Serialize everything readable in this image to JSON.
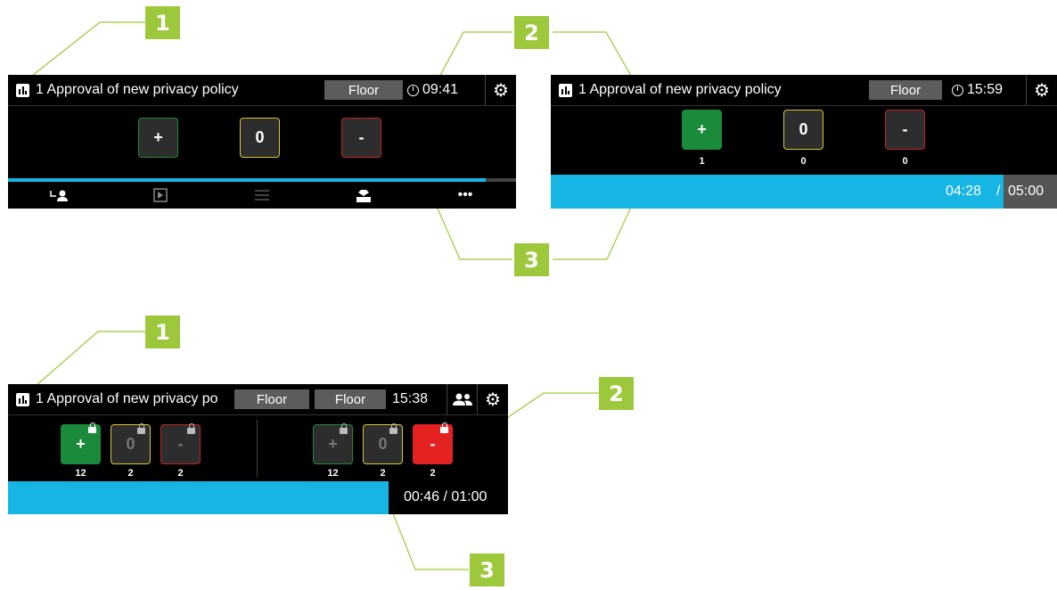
{
  "callouts": {
    "c1": "1",
    "c2": "2",
    "c3": "3"
  },
  "panel_a": {
    "title": "1 Approval of new privacy policy",
    "floor_label": "Floor",
    "time": "09:41",
    "yes_label": "+",
    "abstain_label": "0",
    "no_label": "-",
    "progress_fraction": 0.94,
    "nav_icons": [
      "redirect-user-icon",
      "next-item-icon",
      "list-icon",
      "vote-box-icon",
      "more-icon"
    ],
    "more_label": "•••"
  },
  "panel_b": {
    "title": "1 Approval of new privacy policy",
    "floor_label": "Floor",
    "time": "15:59",
    "yes_label": "+",
    "abstain_label": "0",
    "no_label": "-",
    "yes_count": "1",
    "abstain_count": "0",
    "no_count": "0",
    "timer_elapsed": "04:28",
    "timer_separator": "/",
    "timer_total": "05:00"
  },
  "panel_c": {
    "title": "1 Approval of new privacy po",
    "floor_label_1": "Floor",
    "floor_label_2": "Floor",
    "time": "15:38",
    "left": {
      "yes_label": "+",
      "abstain_label": "0",
      "no_label": "-",
      "yes_count": "12",
      "abstain_count": "2",
      "no_count": "2"
    },
    "right": {
      "yes_label": "+",
      "abstain_label": "0",
      "no_label": "-",
      "yes_count": "12",
      "abstain_count": "2",
      "no_count": "2"
    },
    "timer": "00:46 / 01:00"
  },
  "colors": {
    "yes": "#1b8a3a",
    "abstain": "#d9c62b",
    "no": "#c42020",
    "progress": "#17b5e4",
    "callout": "#9dc83b"
  }
}
